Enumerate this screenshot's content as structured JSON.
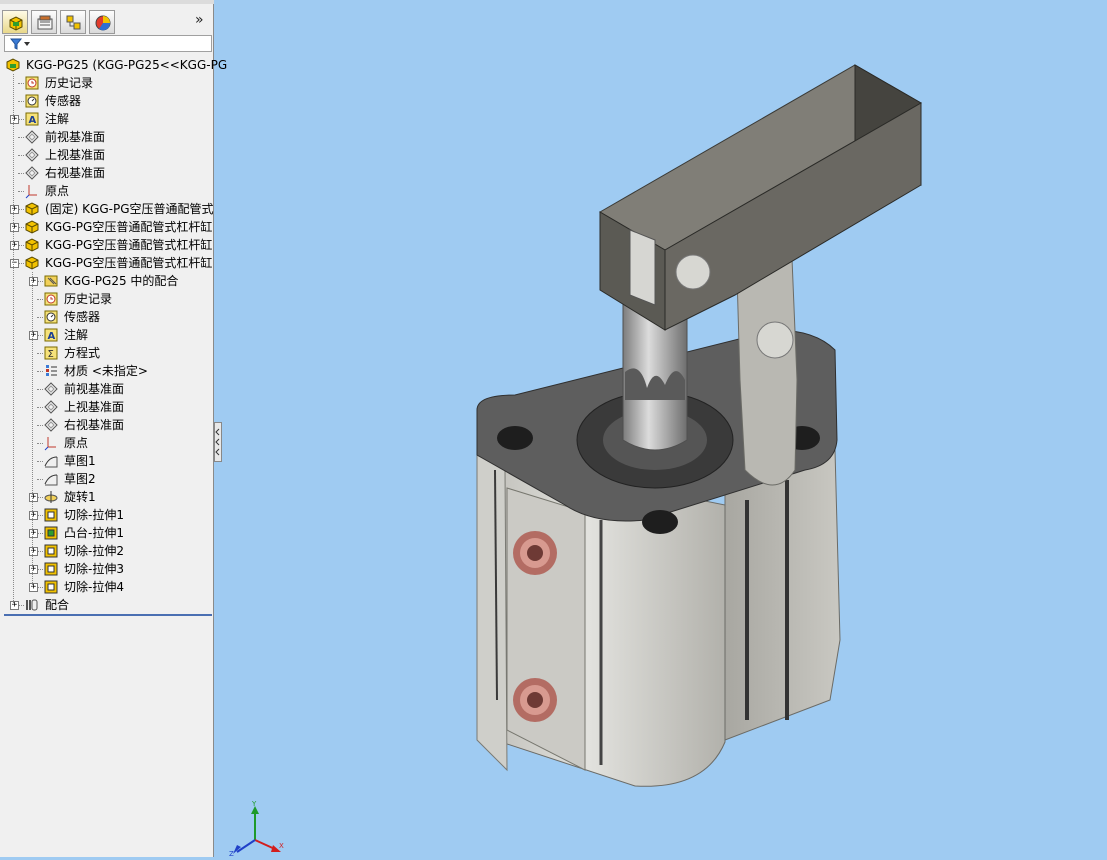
{
  "tabs": [
    "feature-manager",
    "property-manager",
    "configuration-manager",
    "display-manager"
  ],
  "tree": {
    "items": [
      {
        "label": "KGG-PG25  (KGG-PG25<<KGG-PG",
        "icon": "assembly-icon",
        "level": 0,
        "expander": ""
      },
      {
        "label": "历史记录",
        "icon": "history-icon",
        "level": 1,
        "expander": ""
      },
      {
        "label": "传感器",
        "icon": "sensor-icon",
        "level": 1,
        "expander": ""
      },
      {
        "label": "注解",
        "icon": "annotation-icon",
        "level": 1,
        "expander": "+"
      },
      {
        "label": "前视基准面",
        "icon": "plane-icon",
        "level": 1,
        "expander": ""
      },
      {
        "label": "上视基准面",
        "icon": "plane-icon",
        "level": 1,
        "expander": ""
      },
      {
        "label": "右视基准面",
        "icon": "plane-icon",
        "level": 1,
        "expander": ""
      },
      {
        "label": "原点",
        "icon": "origin-icon",
        "level": 1,
        "expander": ""
      },
      {
        "label": "(固定) KGG-PG空压普通配管式",
        "icon": "part-icon",
        "level": 1,
        "expander": "+"
      },
      {
        "label": "KGG-PG空压普通配管式杠杆缸",
        "icon": "part-icon",
        "level": 1,
        "expander": "+"
      },
      {
        "label": "KGG-PG空压普通配管式杠杆缸",
        "icon": "part-icon",
        "level": 1,
        "expander": "+"
      },
      {
        "label": "KGG-PG空压普通配管式杠杆缸",
        "icon": "part-icon",
        "level": 1,
        "expander": "−"
      },
      {
        "label": "KGG-PG25 中的配合",
        "icon": "mates-folder-icon",
        "level": 2,
        "expander": "+"
      },
      {
        "label": "历史记录",
        "icon": "history-icon",
        "level": 2,
        "expander": ""
      },
      {
        "label": "传感器",
        "icon": "sensor-icon",
        "level": 2,
        "expander": ""
      },
      {
        "label": "注解",
        "icon": "annotation-icon",
        "level": 2,
        "expander": "+"
      },
      {
        "label": "方程式",
        "icon": "equation-icon",
        "level": 2,
        "expander": ""
      },
      {
        "label": "材质 <未指定>",
        "icon": "material-icon",
        "level": 2,
        "expander": ""
      },
      {
        "label": "前视基准面",
        "icon": "plane-icon",
        "level": 2,
        "expander": ""
      },
      {
        "label": "上视基准面",
        "icon": "plane-icon",
        "level": 2,
        "expander": ""
      },
      {
        "label": "右视基准面",
        "icon": "plane-icon",
        "level": 2,
        "expander": ""
      },
      {
        "label": "原点",
        "icon": "origin-icon",
        "level": 2,
        "expander": ""
      },
      {
        "label": "草图1",
        "icon": "sketch-icon",
        "level": 2,
        "expander": ""
      },
      {
        "label": "草图2",
        "icon": "sketch-icon",
        "level": 2,
        "expander": ""
      },
      {
        "label": "旋转1",
        "icon": "revolve-icon",
        "level": 2,
        "expander": "+"
      },
      {
        "label": "切除-拉伸1",
        "icon": "cut-extrude-icon",
        "level": 2,
        "expander": "+"
      },
      {
        "label": "凸台-拉伸1",
        "icon": "boss-extrude-icon",
        "level": 2,
        "expander": "+"
      },
      {
        "label": "切除-拉伸2",
        "icon": "cut-extrude-icon",
        "level": 2,
        "expander": "+"
      },
      {
        "label": "切除-拉伸3",
        "icon": "cut-extrude-icon",
        "level": 2,
        "expander": "+"
      },
      {
        "label": "切除-拉伸4",
        "icon": "cut-extrude-icon",
        "level": 2,
        "expander": "+"
      },
      {
        "label": "配合",
        "icon": "mates-icon",
        "level": 1,
        "expander": "+"
      }
    ]
  },
  "viewport": {
    "background": "#9fcbf2",
    "axis_labels": {
      "x": "X",
      "y": "Y",
      "z": "Z"
    },
    "model_colors": {
      "body": "#c9c9c4",
      "top": "#5e5e5e",
      "arm": "#6a6862",
      "fitting": "#c8847a"
    }
  }
}
